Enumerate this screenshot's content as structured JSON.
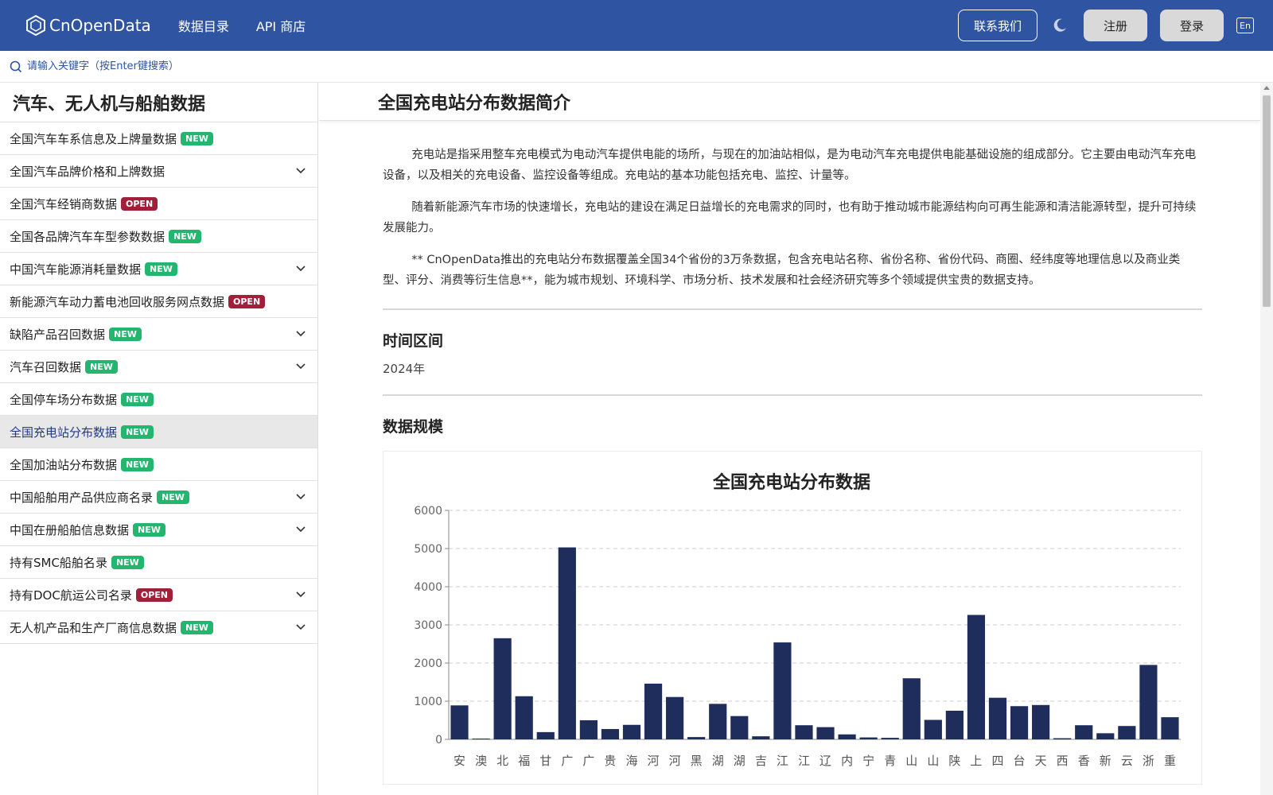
{
  "header": {
    "logo_text": "CnOpenData",
    "nav": [
      "数据目录",
      "API 商店"
    ],
    "contact_label": "联系我们",
    "register_label": "注册",
    "login_label": "登录",
    "lang_label": "En"
  },
  "search": {
    "placeholder": "请输入关键字（按Enter键搜索）"
  },
  "sidebar": {
    "title": "汽车、无人机与船舶数据",
    "items": [
      {
        "label": "全国汽车车系信息及上牌量数据",
        "badge": "NEW",
        "expand": false
      },
      {
        "label": "全国汽车品牌价格和上牌数据",
        "badge": "",
        "expand": true
      },
      {
        "label": "全国汽车经销商数据",
        "badge": "OPEN",
        "expand": false
      },
      {
        "label": "全国各品牌汽车车型参数数据",
        "badge": "NEW",
        "expand": false
      },
      {
        "label": "中国汽车能源消耗量数据",
        "badge": "NEW",
        "expand": true
      },
      {
        "label": "新能源汽车动力蓄电池回收服务网点数据",
        "badge": "OPEN",
        "expand": false
      },
      {
        "label": "缺陷产品召回数据",
        "badge": "NEW",
        "expand": true
      },
      {
        "label": "汽车召回数据",
        "badge": "NEW",
        "expand": true
      },
      {
        "label": "全国停车场分布数据",
        "badge": "NEW",
        "expand": false
      },
      {
        "label": "全国充电站分布数据",
        "badge": "NEW",
        "expand": false,
        "active": true
      },
      {
        "label": "全国加油站分布数据",
        "badge": "NEW",
        "expand": false
      },
      {
        "label": "中国船舶用产品供应商名录",
        "badge": "NEW",
        "expand": true
      },
      {
        "label": "中国在册船舶信息数据",
        "badge": "NEW",
        "expand": true
      },
      {
        "label": "持有SMC船舶名录",
        "badge": "NEW",
        "expand": false
      },
      {
        "label": "持有DOC航运公司名录",
        "badge": "OPEN",
        "expand": true
      },
      {
        "label": "无人机产品和生产厂商信息数据",
        "badge": "NEW",
        "expand": true
      }
    ]
  },
  "main": {
    "title": "全国充电站分布数据简介",
    "paragraphs": [
      "充电站是指采用整车充电模式为电动汽车提供电能的场所，与现在的加油站相似，是为电动汽车充电提供电能基础设施的组成部分。它主要由电动汽车充电设备，以及相关的充电设备、监控设备等组成。充电站的基本功能包括充电、监控、计量等。",
      "随着新能源汽车市场的快速增长，充电站的建设在满足日益增长的充电需求的同时，也有助于推动城市能源结构向可再生能源和清洁能源转型，提升可持续发展能力。",
      "** CnOpenData推出的充电站分布数据覆盖全国34个省份的3万条数据，包含充电站名称、省份名称、省份代码、商圈、经纬度等地理信息以及商业类型、评分、消费等衍生信息**，能为城市规划、环境科学、市场分析、技术发展和社会经济研究等多个领域提供宝贵的数据支持。"
    ],
    "period_title": "时间区间",
    "period_value": "2024年",
    "scale_title": "数据规模"
  },
  "colors": {
    "header_bg": "#2e54a2",
    "bar": "#1f2d5c",
    "badge_new": "#23b66f",
    "badge_open": "#a21f3a"
  },
  "chart_data": {
    "type": "bar",
    "title": "全国充电站分布数据",
    "categories": [
      "安",
      "澳",
      "北",
      "福",
      "甘",
      "广",
      "广",
      "贵",
      "海",
      "河",
      "河",
      "黑",
      "湖",
      "湖",
      "吉",
      "江",
      "江",
      "辽",
      "内",
      "宁",
      "青",
      "山",
      "山",
      "陕",
      "上",
      "四",
      "台",
      "天",
      "西",
      "香",
      "新",
      "云",
      "浙",
      "重"
    ],
    "values": [
      890,
      20,
      2650,
      1130,
      190,
      5030,
      500,
      270,
      380,
      1460,
      1110,
      60,
      930,
      610,
      80,
      2540,
      370,
      320,
      130,
      50,
      40,
      1600,
      510,
      750,
      3260,
      1090,
      870,
      900,
      30,
      370,
      160,
      350,
      1950,
      580
    ],
    "ylim": [
      0,
      6000
    ],
    "yticks": [
      0,
      1000,
      2000,
      3000,
      4000,
      5000,
      6000
    ],
    "grid": true
  }
}
